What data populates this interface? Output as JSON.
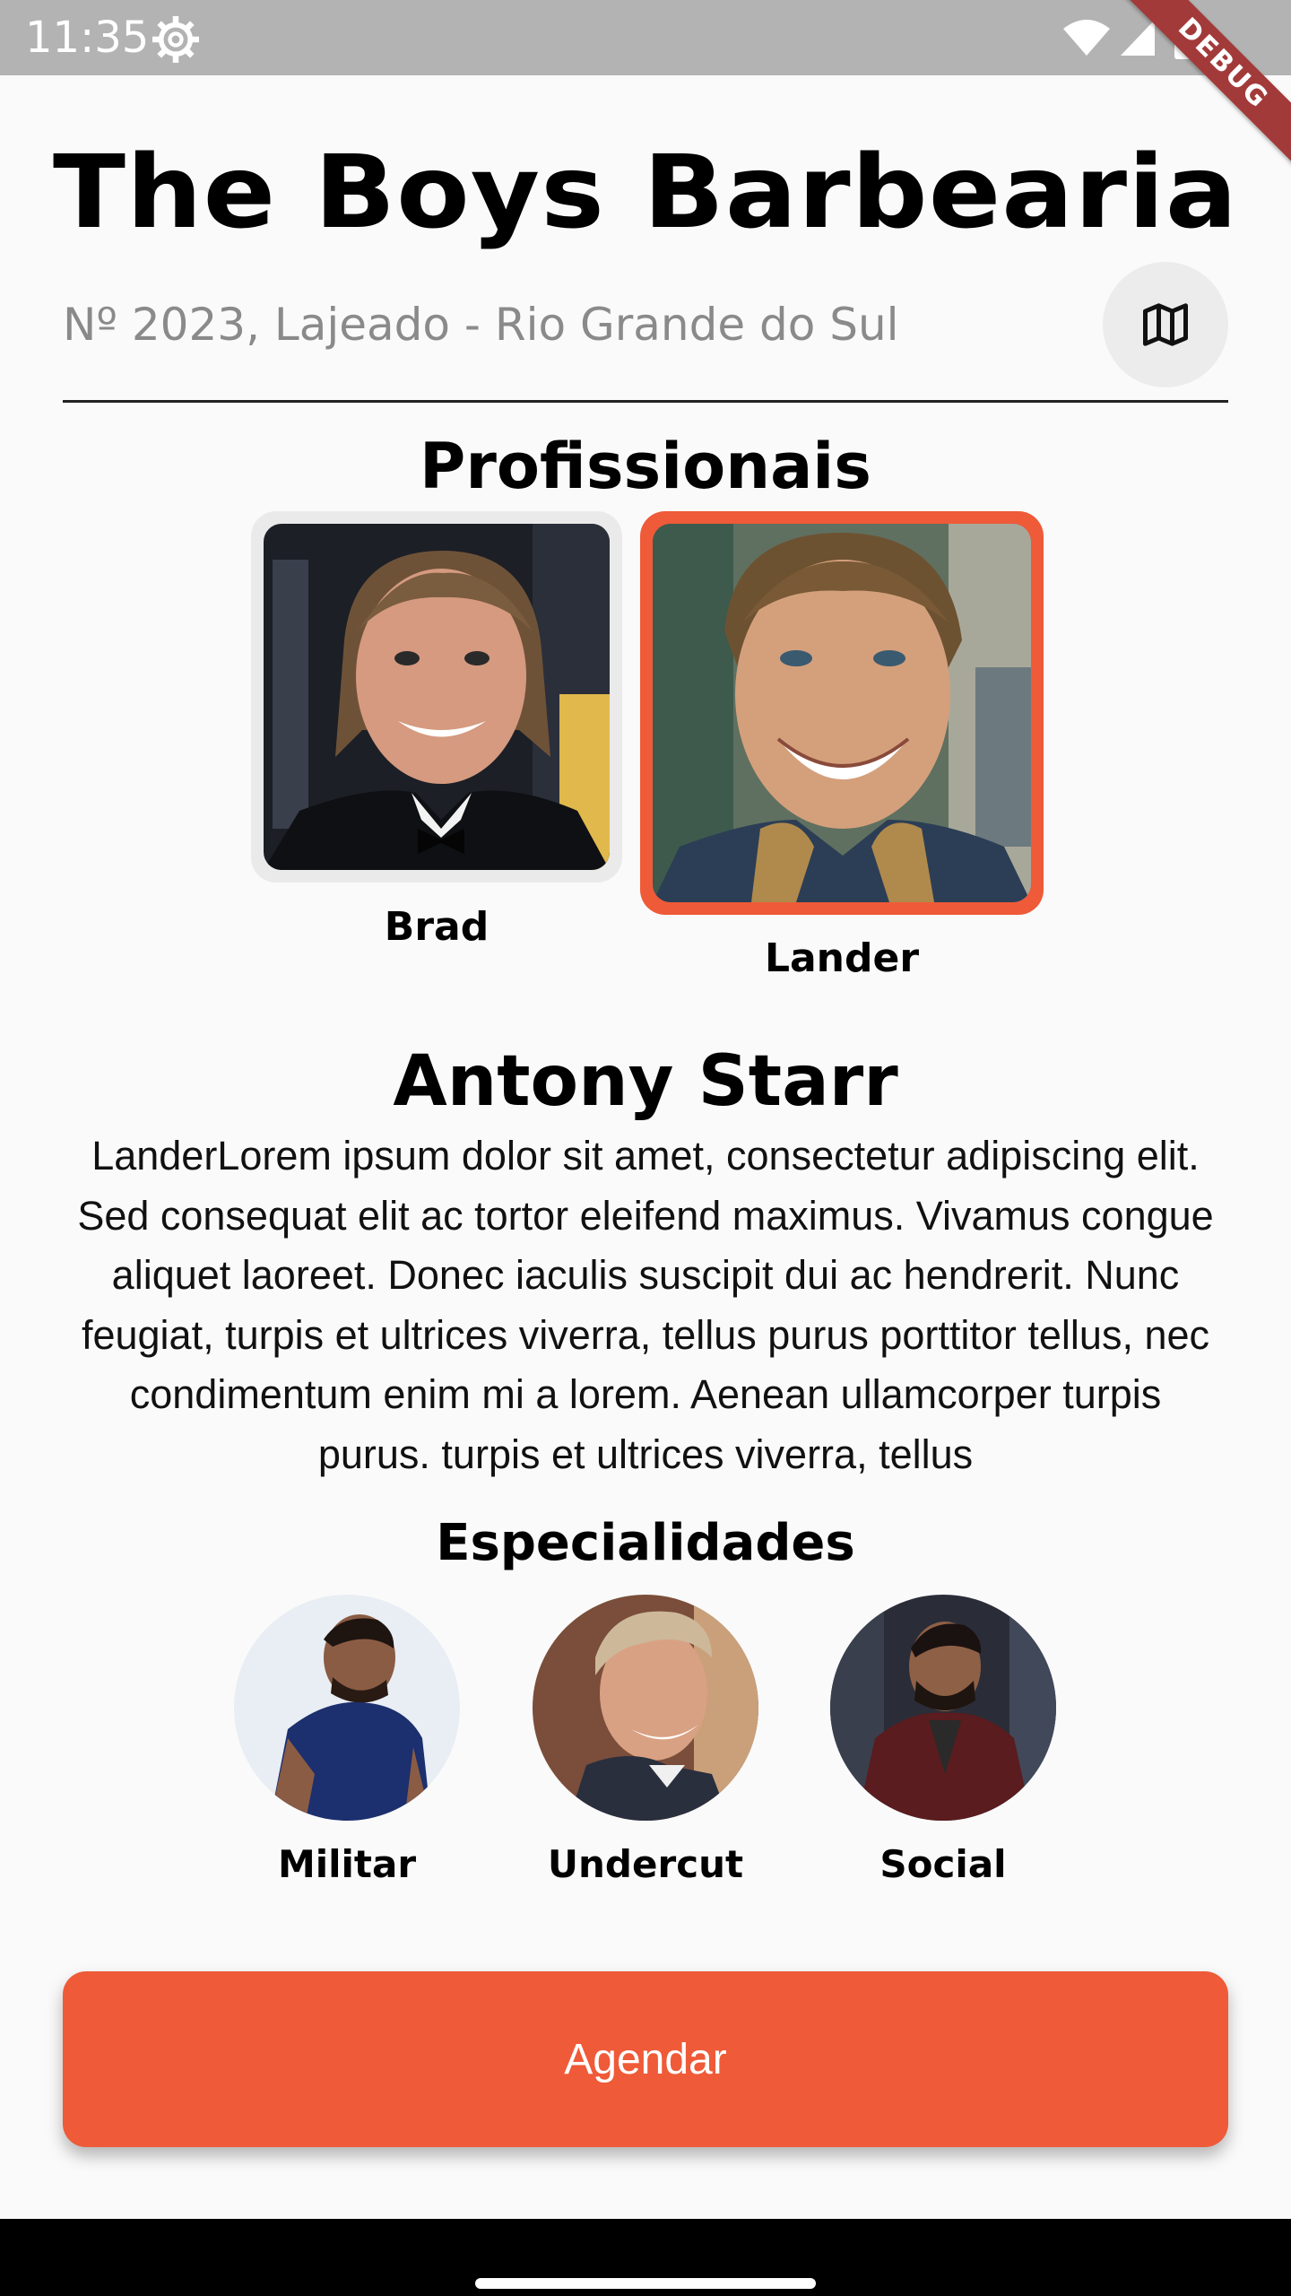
{
  "status_bar": {
    "time": "11:35",
    "debug_label": "DEBUG"
  },
  "header": {
    "title": "The Boys Barbearia",
    "address": "Nº 2023, Lajeado - Rio Grande do Sul",
    "map_icon": "map-icon"
  },
  "professionals": {
    "title": "Profissionais",
    "items": [
      {
        "name": "Brad",
        "selected": false
      },
      {
        "name": "Lander",
        "selected": true
      }
    ]
  },
  "selected_professional": {
    "name": "Antony Starr",
    "description": "LanderLorem ipsum dolor sit amet, consectetur adipiscing elit. Sed consequat elit ac tortor eleifend maximus. Vivamus congue aliquet laoreet. Donec iaculis suscipit dui ac hendrerit. Nunc feugiat, turpis et ultrices viverra, tellus purus porttitor tellus, nec condimentum enim mi a lorem. Aenean ullamcorper turpis purus. turpis et ultrices viverra, tellus"
  },
  "specialties": {
    "title": "Especialidades",
    "items": [
      {
        "label": "Militar"
      },
      {
        "label": "Undercut"
      },
      {
        "label": "Social"
      }
    ]
  },
  "cta": {
    "label": "Agendar"
  },
  "colors": {
    "accent": "#ef5a38",
    "status_bar": "#b3b3b3",
    "background": "#fafafa"
  }
}
